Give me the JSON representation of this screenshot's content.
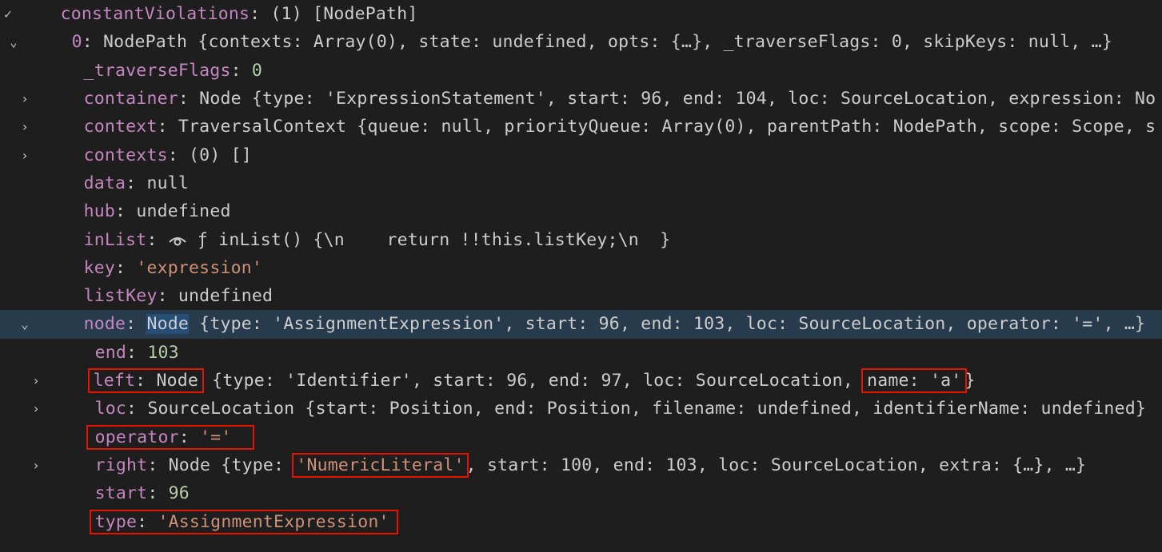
{
  "rows": {
    "r0": {
      "key": "constantViolations",
      "sep": ": ",
      "val": "(1) [NodePath]"
    },
    "r1": {
      "key": "0",
      "sep": ": ",
      "val": "NodePath {contexts: Array(0), state: undefined, opts: {…}, _traverseFlags: 0, skipKeys: null, …}"
    },
    "r2": {
      "key": "_traverseFlags",
      "sep": ": ",
      "val": "0"
    },
    "r3": {
      "key": "container",
      "sep": ": ",
      "val": "Node {type: 'ExpressionStatement', start: 96, end: 104, loc: SourceLocation, expression: No"
    },
    "r4": {
      "key": "context",
      "sep": ": ",
      "val": "TraversalContext {queue: null, priorityQueue: Array(0), parentPath: NodePath, scope: Scope, s"
    },
    "r5": {
      "key": "contexts",
      "sep": ": ",
      "val": "(0) []"
    },
    "r6": {
      "key": "data",
      "sep": ": ",
      "val": "null"
    },
    "r7": {
      "key": "hub",
      "sep": ": ",
      "val": "undefined"
    },
    "r8": {
      "key": "inList",
      "sep": ": ",
      "icon": "eye-icon",
      "val": " ƒ inList() {\\n    return !!this.listKey;\\n  }"
    },
    "r9": {
      "key": "key",
      "sep": ": ",
      "val": "'expression'"
    },
    "r10": {
      "key": "listKey",
      "sep": ": ",
      "val": "undefined"
    },
    "r11": {
      "key": "node",
      "sep": ": ",
      "hl": "Node",
      "val": " {type: 'AssignmentExpression', start: 96, end: 103, loc: SourceLocation, operator: '=', …}"
    },
    "r12": {
      "key": "end",
      "sep": ": ",
      "val": "103"
    },
    "r13": {
      "key": "left",
      "sep": ": ",
      "boxed": "Node",
      "mid": " {type: 'Identifier', start: 96, end: 97, loc: SourceLocation, ",
      "box2": "name: 'a'",
      "tail": "}"
    },
    "r14": {
      "key": "loc",
      "sep": ": ",
      "val": "SourceLocation {start: Position, end: Position, filename: undefined, identifierName: undefined}"
    },
    "r15": {
      "key": "operator",
      "sep": ": ",
      "val": "'='"
    },
    "r16": {
      "key": "right",
      "sep": ": ",
      "pre": "Node {type: ",
      "box": "'NumericLiteral'",
      "post": ", start: 100, end: 103, loc: SourceLocation, extra: {…}, …}"
    },
    "r17": {
      "key": "start",
      "sep": ": ",
      "val": "96"
    },
    "r18": {
      "key": "type",
      "sep": ": ",
      "val": "'AssignmentExpression'"
    }
  }
}
